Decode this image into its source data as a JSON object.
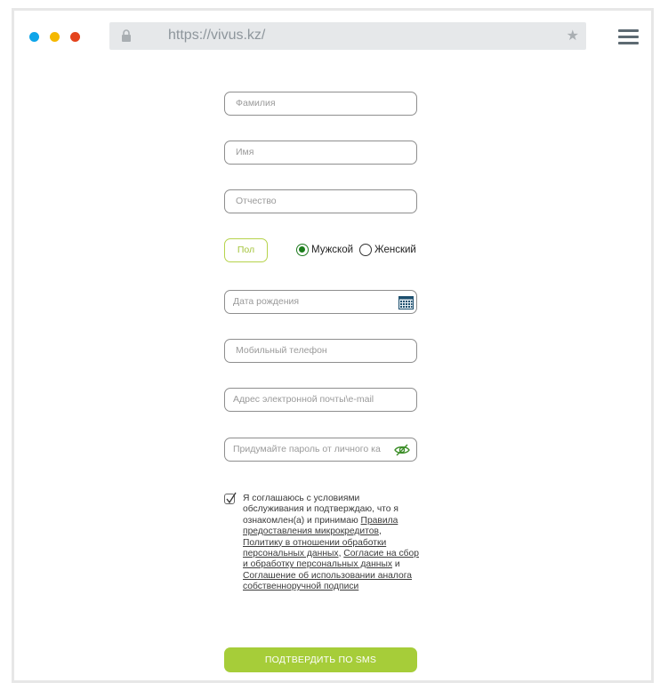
{
  "browser": {
    "url": "https://vivus.kz/",
    "lock_icon": "lock-icon",
    "star_icon": "star-icon",
    "menu_icon": "hamburger-menu-icon",
    "window_dots": [
      "#0ea5e9",
      "#f5b800",
      "#e4431d"
    ]
  },
  "form": {
    "last_name_placeholder": "Фамилия",
    "first_name_placeholder": "Имя",
    "patronymic_placeholder": "Отчество",
    "gender_label": "Пол",
    "gender_options": [
      {
        "label": "Мужской",
        "selected": true
      },
      {
        "label": "Женский",
        "selected": false
      }
    ],
    "birth_date_placeholder": "Дата рождения",
    "phone_placeholder": "Мобильный телефон",
    "email_placeholder": "Адрес электронной почты\\e-mail",
    "password_placeholder": "Придумайте пароль от личного ка",
    "consent": {
      "checked": true,
      "text_1": "Я соглашаюсь с условиями обслуживания и подтверждаю, что я ознакомлен(а) и принимаю ",
      "link_rules": "Правила предоставления микрокредитов",
      "sep_1": ", ",
      "link_policy": "Политику в отношении обработки персональных данных",
      "sep_2": ", ",
      "link_agreement": "Согласие на сбор и обработку персональных данных",
      "sep_3": " и ",
      "link_signature": "Соглашение об использовании аналога собственноручной подписи"
    },
    "submit_label": "ПОДТВЕРДИТЬ ПО SMS"
  },
  "colors": {
    "accent": "#a6cd39",
    "radio_selected": "#1b7d1b"
  }
}
